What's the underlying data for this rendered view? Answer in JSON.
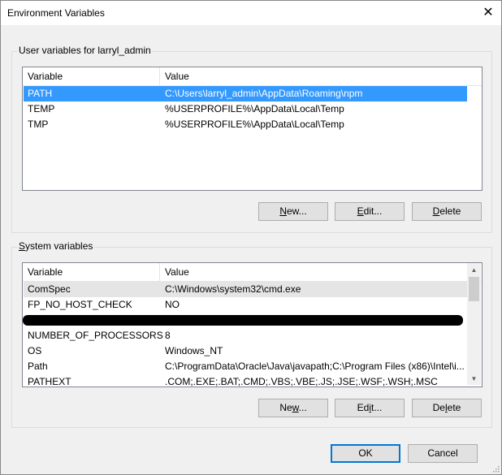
{
  "window": {
    "title": "Environment Variables",
    "close_glyph": "✕"
  },
  "user_vars": {
    "legend": "User variables for larryl_admin",
    "columns": [
      "Variable",
      "Value"
    ],
    "rows": [
      {
        "name": "PATH",
        "value": "C:\\Users\\larryl_admin\\AppData\\Roaming\\npm"
      },
      {
        "name": "TEMP",
        "value": "%USERPROFILE%\\AppData\\Local\\Temp"
      },
      {
        "name": "TMP",
        "value": "%USERPROFILE%\\AppData\\Local\\Temp"
      }
    ],
    "buttons": {
      "new": {
        "mnemonic": "N",
        "rest": "ew..."
      },
      "edit": {
        "mnemonic": "E",
        "rest": "dit..."
      },
      "delete": {
        "mnemonic": "D",
        "rest": "elete"
      }
    }
  },
  "system_vars": {
    "legend_mnemonic": "S",
    "legend_rest": "ystem variables",
    "columns": [
      "Variable",
      "Value"
    ],
    "rows": [
      {
        "name": "ComSpec",
        "value": "C:\\Windows\\system32\\cmd.exe"
      },
      {
        "name": "FP_NO_HOST_CHECK",
        "value": "NO"
      },
      {
        "name": "",
        "value": ""
      },
      {
        "name": "NUMBER_OF_PROCESSORS",
        "value": "8"
      },
      {
        "name": "OS",
        "value": "Windows_NT"
      },
      {
        "name": "Path",
        "value": "C:\\ProgramData\\Oracle\\Java\\javapath;C:\\Program Files (x86)\\Intel\\i..."
      },
      {
        "name": "PATHEXT",
        "value": ".COM;.EXE;.BAT;.CMD;.VBS;.VBE;.JS;.JSE;.WSF;.WSH;.MSC"
      }
    ],
    "buttons": {
      "new_a": "Ne",
      "new_mn": "w",
      "new_b": "...",
      "edit_a": "Ed",
      "edit_mn": "i",
      "edit_b": "t...",
      "delete_a": "De",
      "delete_mn": "l",
      "delete_b": "ete"
    }
  },
  "footer": {
    "ok": "OK",
    "cancel": "Cancel"
  },
  "colors": {
    "selection": "#3399ff",
    "default_button_border": "#0078d7"
  }
}
